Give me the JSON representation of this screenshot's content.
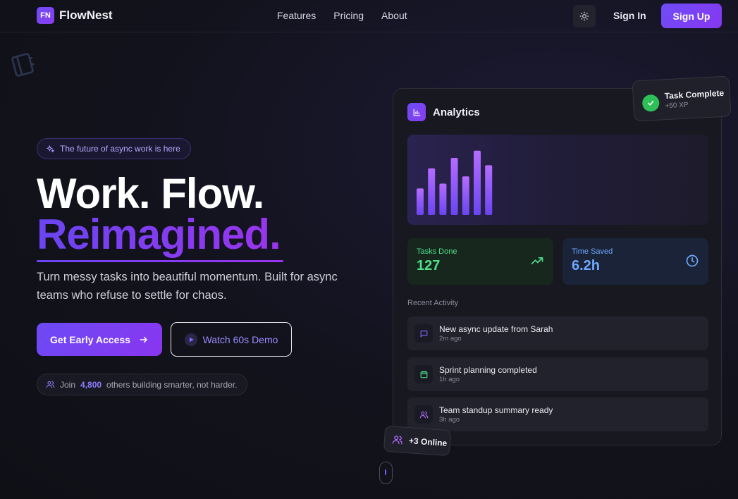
{
  "nav": {
    "logo_mark": "FN",
    "logo_text": "FlowNest",
    "links": [
      "Features",
      "Pricing",
      "About"
    ],
    "sign_in": "Sign In",
    "sign_up": "Sign Up"
  },
  "hero": {
    "badge": "The future of async work is here",
    "headline_line1": "Work. Flow.",
    "headline_line2": "Reimagined.",
    "subtitle": "Turn messy tasks into beautiful momentum. Built for async teams who refuse to settle for chaos.",
    "cta_primary": "Get Early Access",
    "cta_secondary": "Watch 60s Demo",
    "join_prefix": "Join",
    "join_count": "4,800",
    "join_suffix": "others building smarter, not harder."
  },
  "card": {
    "title": "Analytics",
    "bars": [
      0.33,
      0.58,
      0.39,
      0.71,
      0.48,
      0.8,
      0.62
    ],
    "stats": {
      "tasks_label": "Tasks Done",
      "tasks_value": "127",
      "time_label": "Time Saved",
      "time_value": "6.2h"
    },
    "recent_label": "Recent Activity",
    "activities": [
      {
        "title": "New async update from Sarah",
        "time": "2m ago",
        "icon": "message-icon"
      },
      {
        "title": "Sprint planning completed",
        "time": "1h ago",
        "icon": "calendar-icon"
      },
      {
        "title": "Team standup summary ready",
        "time": "3h ago",
        "icon": "users-icon"
      }
    ]
  },
  "toast": {
    "title": "Task Complete",
    "subtitle": "+50 XP"
  },
  "online": {
    "label": "+3 Online"
  },
  "colors": {
    "accent": "#6f4df6",
    "accent2": "#8a35ef",
    "green": "#4fe08a",
    "blue": "#6fa8ff"
  }
}
